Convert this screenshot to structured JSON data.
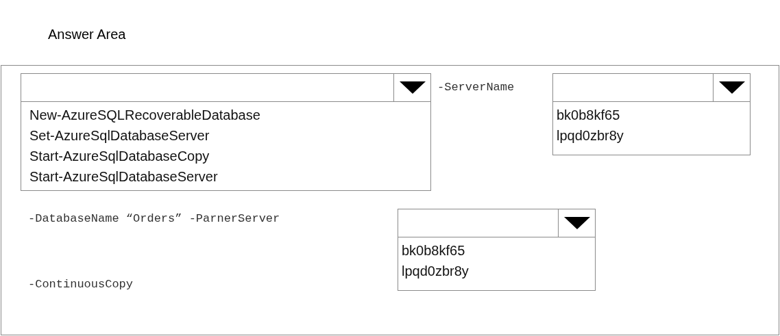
{
  "title": "Answer Area",
  "cmdlet_dropdown": {
    "options": [
      {
        "label": "New-AzureSQLRecoverableDatabase",
        "selected": false
      },
      {
        "label": "Set-AzureSqlDatabaseServer",
        "selected": false
      },
      {
        "label": "Start-AzureSqlDatabaseCopy",
        "selected": false
      },
      {
        "label": "Start-AzureSqlDatabaseServer",
        "selected": false
      }
    ]
  },
  "server_label": "-ServerName",
  "server_dropdown": {
    "options": [
      {
        "label": "bk0b8kf65",
        "selected": false
      },
      {
        "label": "lpqd0zbr8y",
        "selected": false
      }
    ]
  },
  "database_label": "-DatabaseName “Orders” -ParnerServer",
  "partner_dropdown": {
    "options": [
      {
        "label": "bk0b8kf65",
        "selected": false
      },
      {
        "label": "lpqd0zbr8y",
        "selected": false
      }
    ]
  },
  "continuous_label": "-ContinuousCopy"
}
